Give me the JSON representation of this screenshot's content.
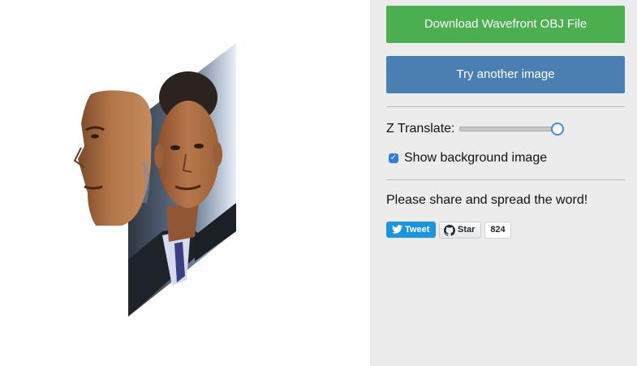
{
  "panel": {
    "download_label": "Download Wavefront OBJ File",
    "try_label": "Try another image",
    "z_translate_label": "Z Translate:",
    "z_translate_value": 1.0,
    "show_bg_label": "Show background image",
    "show_bg_checked": true,
    "share_text": "Please share and spread the word!",
    "tweet_label": "Tweet",
    "star_label": "Star",
    "star_count": "824"
  },
  "colors": {
    "download": "#4bae4f",
    "try": "#4a80b1",
    "panel_bg": "#ececec",
    "tweet": "#1b95e0",
    "accent": "#2f7fe2"
  },
  "icons": {
    "tweet": "twitter-bird-icon",
    "star": "github-octocat-icon",
    "checkbox": "checkmark-icon"
  }
}
